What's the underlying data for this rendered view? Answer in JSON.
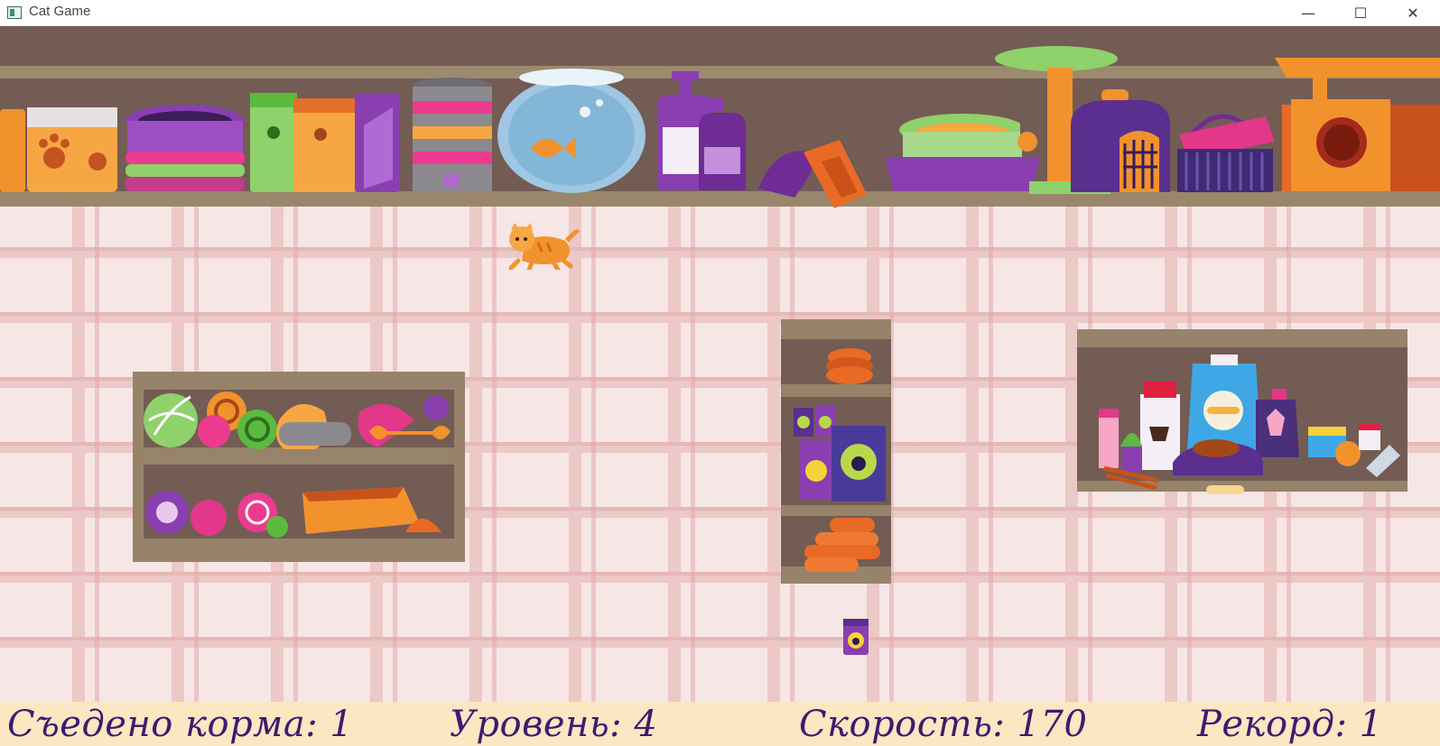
{
  "window": {
    "title": "Cat Game",
    "minimize_glyph": "—",
    "maximize_glyph": "☐",
    "close_glyph": "✕"
  },
  "status": {
    "eaten": "Съедено корма: 1",
    "level": "Уровень: 4",
    "speed": "Скорость: 170",
    "record": "Рекорд: 1"
  },
  "colors": {
    "shelf_wood": "#96836a",
    "shelf_back": "#735c54",
    "floor": "#f7e6e6",
    "status_bg": "#fde6c2",
    "status_text": "#3b1c6e",
    "cat": "#f2922c"
  }
}
